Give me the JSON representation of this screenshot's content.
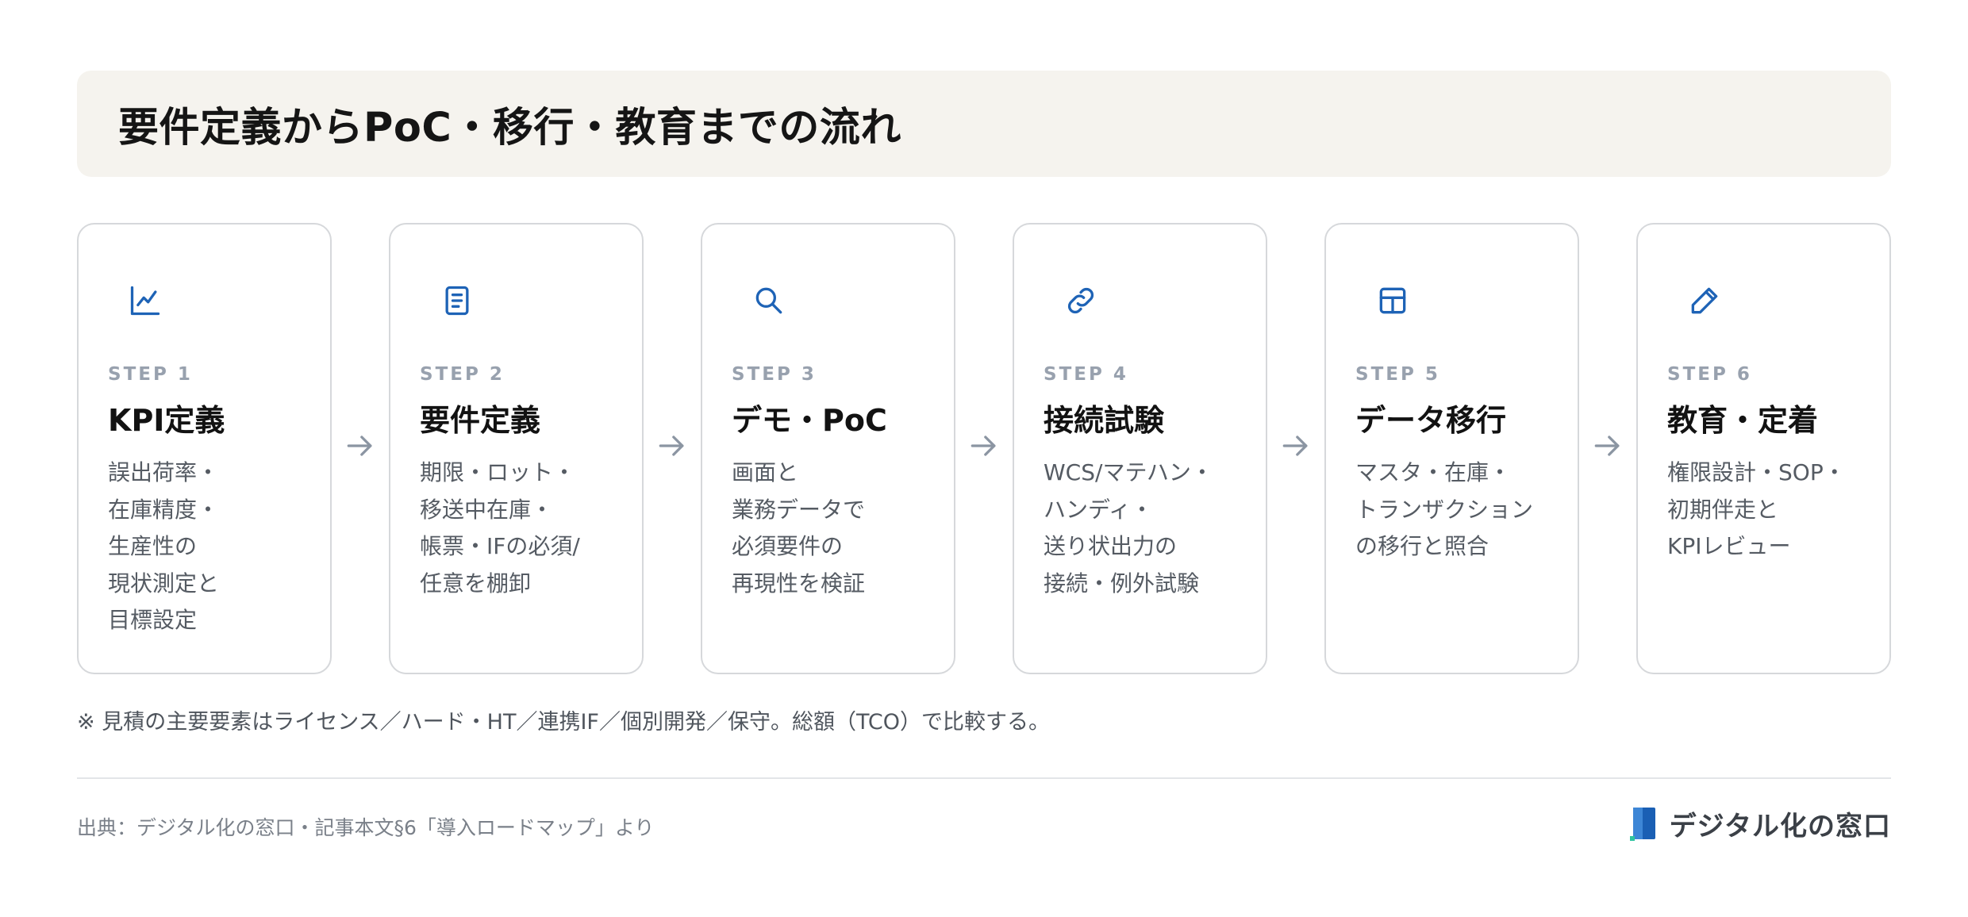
{
  "title": "要件定義からPoC・移行・教育までの流れ",
  "steps": [
    {
      "icon": "line-chart-icon",
      "label": "STEP 1",
      "title": "KPI定義",
      "desc": [
        "誤出荷率・",
        "在庫精度・",
        "生産性の",
        "現状測定と",
        "目標設定"
      ]
    },
    {
      "icon": "document-icon",
      "label": "STEP 2",
      "title": "要件定義",
      "desc": [
        "期限・ロット・",
        "移送中在庫・",
        "帳票・IFの必須/",
        "任意を棚卸"
      ]
    },
    {
      "icon": "search-icon",
      "label": "STEP 3",
      "title": "デモ・PoC",
      "desc": [
        "画面と",
        "業務データで",
        "必須要件の",
        "再現性を検証"
      ]
    },
    {
      "icon": "link-icon",
      "label": "STEP 4",
      "title": "接続試験",
      "desc": [
        "WCS/マテハン・",
        "ハンディ・",
        "送り状出力の",
        "接続・例外試験"
      ]
    },
    {
      "icon": "table-icon",
      "label": "STEP 5",
      "title": "データ移行",
      "desc": [
        "マスタ・在庫・",
        "トランザクション",
        "の移行と照合"
      ]
    },
    {
      "icon": "pencil-icon",
      "label": "STEP 6",
      "title": "教育・定着",
      "desc": [
        "権限設計・SOP・",
        "初期伴走と",
        "KPIレビュー"
      ]
    }
  ],
  "note": "※ 見積の主要要素はライセンス／ハード・HT／連携IF／個別開発／保守。総額（TCO）で比較する。",
  "source": "出典：デジタル化の窓口・記事本文§6「導入ロードマップ」より",
  "logo": {
    "name": "デジタル化の窓口",
    "colors": {
      "blue": "#1a5fb4",
      "green": "#2ec4a0"
    }
  },
  "colors": {
    "accent": "#1e63b6",
    "title_bg": "#f5f3ee",
    "card_border": "#d6d8db",
    "step_label": "#98a1ae"
  }
}
